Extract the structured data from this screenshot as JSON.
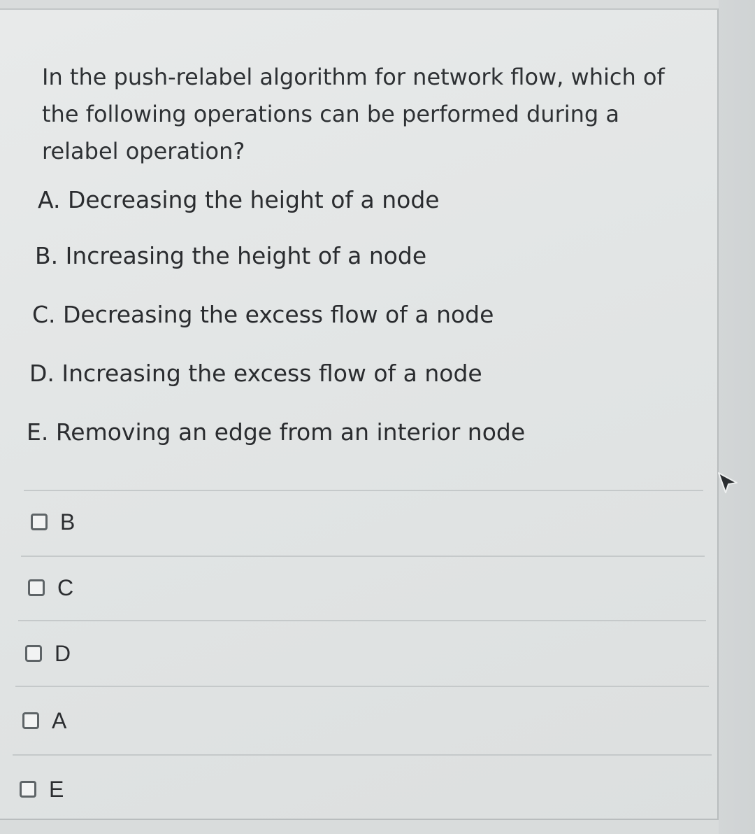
{
  "question": {
    "line1": "In the push-relabel algorithm for network flow, which of",
    "line2": "the following operations can be performed during a",
    "line3": "relabel operation?"
  },
  "options": [
    {
      "text": "A. Decreasing the height of a node"
    },
    {
      "text": "B. Increasing the height of a node"
    },
    {
      "text": "C. Decreasing the excess flow of a node"
    },
    {
      "text": "D. Increasing the excess flow of a node"
    },
    {
      "text": "E. Removing an edge from an interior node"
    }
  ],
  "answers": [
    {
      "label": "B",
      "checked": false
    },
    {
      "label": "C",
      "checked": false
    },
    {
      "label": "D",
      "checked": false
    },
    {
      "label": "A",
      "checked": false
    },
    {
      "label": "E",
      "checked": false
    }
  ]
}
